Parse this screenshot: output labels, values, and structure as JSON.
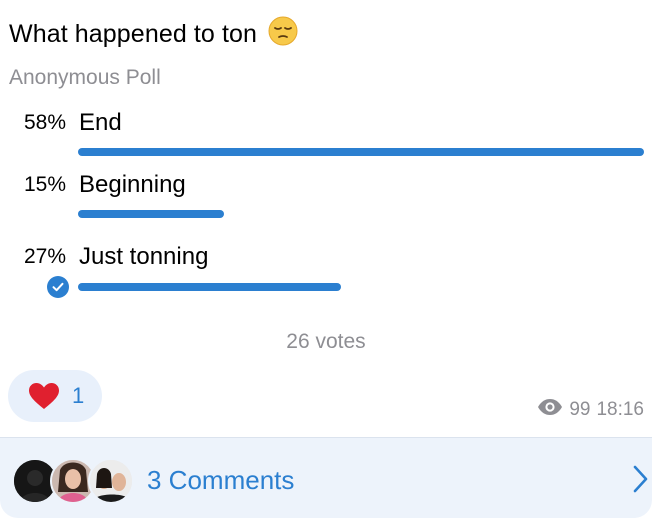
{
  "poll": {
    "question": "What happened to ton",
    "type": "Anonymous Poll",
    "options": [
      {
        "percent": "58%",
        "label": "End",
        "fraction": 0.58,
        "chosen": false
      },
      {
        "percent": "15%",
        "label": "Beginning",
        "fraction": 0.15,
        "chosen": false
      },
      {
        "percent": "27%",
        "label": "Just tonning",
        "fraction": 0.27,
        "chosen": true
      }
    ],
    "votes": "26 votes",
    "accent": "#2b7fd0"
  },
  "reactions": {
    "count": "1",
    "icon": "heart-icon"
  },
  "meta": {
    "views": "99",
    "time": "18:16"
  },
  "comments": {
    "label": "3 Comments"
  }
}
